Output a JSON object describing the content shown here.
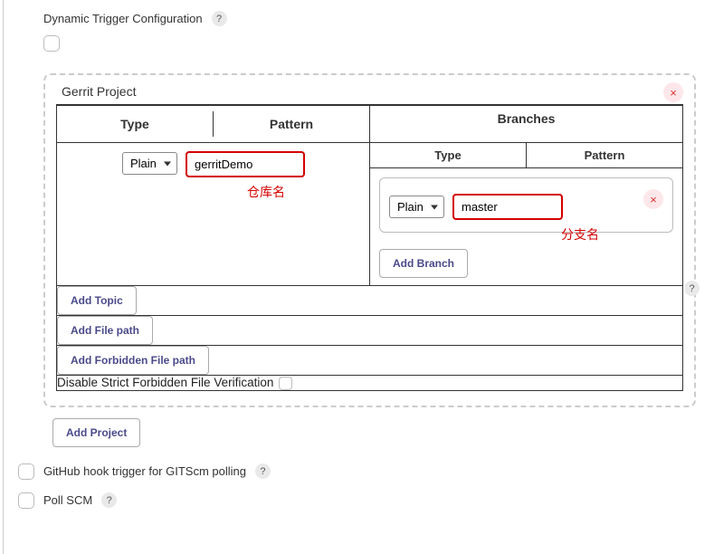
{
  "dynamic_trigger_label": "Dynamic Trigger Configuration",
  "help_glyph": "?",
  "gerrit": {
    "title": "Gerrit Project",
    "headers": {
      "type": "Type",
      "pattern": "Pattern",
      "branches": "Branches"
    },
    "project": {
      "type_option": "Plain",
      "pattern_value": "gerritDemo",
      "annotation": "仓库名"
    },
    "branch": {
      "type_option": "Plain",
      "pattern_value": "master",
      "annotation": "分支名",
      "add_label": "Add Branch"
    },
    "buttons": {
      "add_topic": "Add Topic",
      "add_file_path": "Add File path",
      "add_forbidden": "Add Forbidden File path"
    },
    "disable_label": "Disable Strict Forbidden File Verification"
  },
  "add_project_label": "Add Project",
  "github_hook_label": "GitHub hook trigger for GITScm polling",
  "poll_scm_label": "Poll SCM",
  "close_glyph": "×"
}
